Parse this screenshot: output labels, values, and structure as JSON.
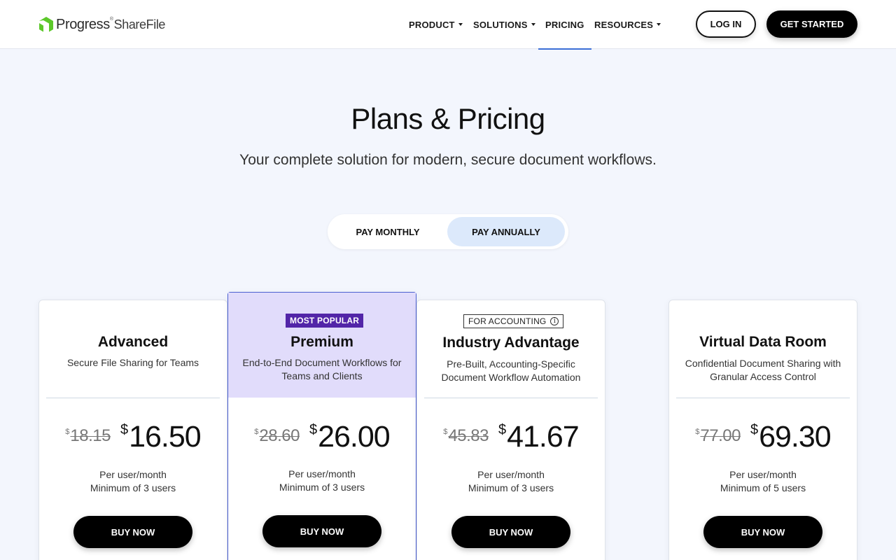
{
  "header": {
    "logo": {
      "brand": "Progress",
      "product": "ShareFile",
      "reg": "®"
    },
    "nav": [
      {
        "label": "PRODUCT",
        "dropdown": true
      },
      {
        "label": "SOLUTIONS",
        "dropdown": true
      },
      {
        "label": "PRICING",
        "dropdown": false,
        "active": true
      },
      {
        "label": "RESOURCES",
        "dropdown": true
      }
    ],
    "login_label": "LOG IN",
    "get_started_label": "GET STARTED"
  },
  "hero": {
    "title": "Plans & Pricing",
    "subtitle": "Your complete solution for modern, secure document workflows."
  },
  "billing_toggle": {
    "monthly_label": "PAY MONTHLY",
    "annually_label": "PAY ANNUALLY",
    "selected": "annually"
  },
  "plans": [
    {
      "name": "Advanced",
      "description": "Secure File Sharing for Teams",
      "currency": "$",
      "old_price": "18.15",
      "price": "16.50",
      "per_line1": "Per user/month",
      "per_line2": "Minimum of 3 users",
      "buy_label": "BUY NOW"
    },
    {
      "badge": "MOST POPULAR",
      "name": "Premium",
      "description": "End-to-End Document Workflows for Teams and Clients",
      "currency": "$",
      "old_price": "28.60",
      "price": "26.00",
      "per_line1": "Per user/month",
      "per_line2": "Minimum of 3 users",
      "buy_label": "BUY NOW"
    },
    {
      "badge": "FOR ACCOUNTING",
      "badge_icon": "info-icon",
      "name": "Industry Advantage",
      "description": "Pre-Built, Accounting-Specific Document Workflow Automation",
      "currency": "$",
      "old_price": "45.83",
      "price": "41.67",
      "per_line1": "Per user/month",
      "per_line2": "Minimum of 3 users",
      "buy_label": "BUY NOW"
    },
    {
      "name": "Virtual Data Room",
      "description": "Confidential Document Sharing with Granular Access Control",
      "currency": "$",
      "old_price": "77.00",
      "price": "69.30",
      "per_line1": "Per user/month",
      "per_line2": "Minimum of 5 users",
      "buy_label": "BUY NOW"
    }
  ],
  "colors": {
    "accent_green": "#5cc82a",
    "popular_bg": "#e1dcfb",
    "popular_badge": "#5225a8",
    "toggle_selected": "#dce9fb",
    "nav_active": "#3c6fd6"
  }
}
